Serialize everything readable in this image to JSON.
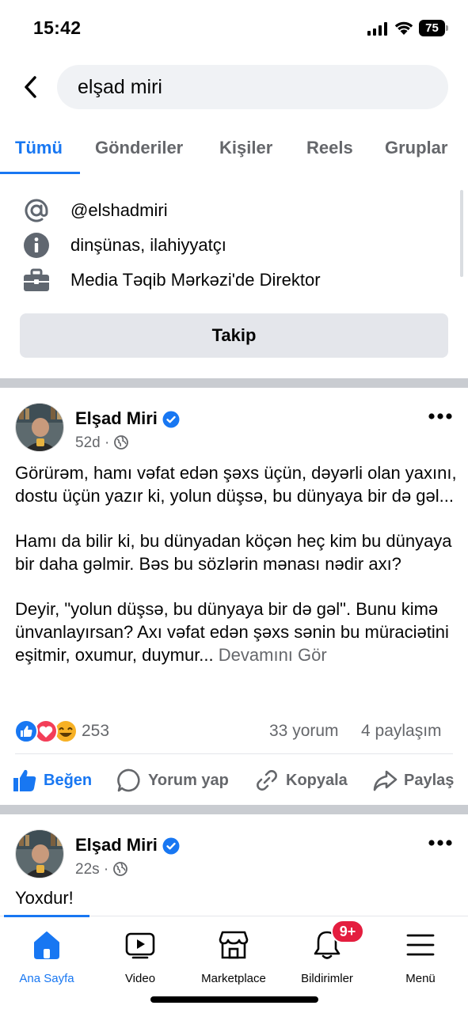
{
  "status_bar": {
    "time": "15:42",
    "battery": "75"
  },
  "search": {
    "query": "elşad miri"
  },
  "tabs": [
    {
      "label": "Tümü",
      "active": true
    },
    {
      "label": "Gönderiler"
    },
    {
      "label": "Kişiler"
    },
    {
      "label": "Reels"
    },
    {
      "label": "Gruplar"
    }
  ],
  "profile_info": {
    "username": "@elshadmiri",
    "bio": "dinşünas, ilahiyyatçı",
    "work": "Media Təqib Mərkəzi'de Direktor"
  },
  "follow_label": "Takip",
  "posts": [
    {
      "author": "Elşad Miri",
      "time": "52d",
      "paragraphs": [
        "Görürəm, hamı vəfat edən şəxs üçün, dəyərli olan yaxını, dostu üçün yazır ki, yolun düşsə, bu dünyaya bir də gəl...",
        "Hamı da bilir ki, bu dünyadan köçən heç kim bu dünyaya bir daha gəlmir. Bəs bu sözlərin mənası nədir axı?",
        "Deyir, \"yolun düşsə, bu dünyaya bir də gəl\". Bunu kimə ünvanlayırsan? Axı vəfat edən şəxs sənin bu müraciətini eşitmir, oxumur, duymur..."
      ],
      "see_more": "Devamını Gör",
      "reaction_count": "253",
      "comments": "33 yorum",
      "shares": "4 paylaşım",
      "actions": {
        "like": "Beğen",
        "comment": "Yorum yap",
        "copy": "Kopyala",
        "share": "Paylaş"
      }
    },
    {
      "author": "Elşad Miri",
      "time": "22s",
      "text": "Yoxdur!"
    }
  ],
  "bottom_nav": [
    {
      "label": "Ana Sayfa",
      "active": true
    },
    {
      "label": "Video"
    },
    {
      "label": "Marketplace"
    },
    {
      "label": "Bildirimler",
      "badge": "9+"
    },
    {
      "label": "Menü"
    }
  ],
  "colors": {
    "accent": "#1877f2",
    "badge": "#e41e3f",
    "muted": "#65676b"
  }
}
